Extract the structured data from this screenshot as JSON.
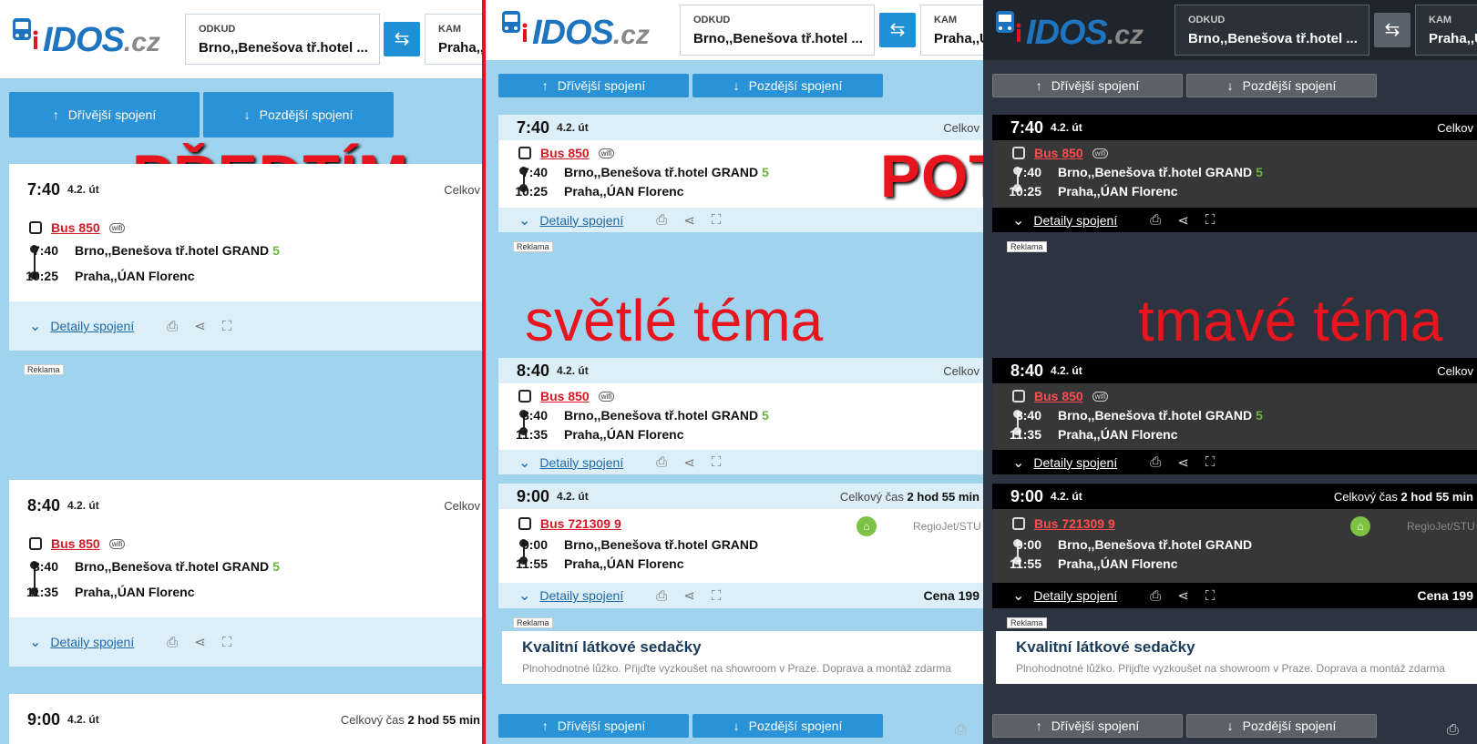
{
  "logo": {
    "word": "IDOS",
    "tld": ".cz"
  },
  "search": {
    "from_label": "ODKUD",
    "from_value": "Brno,,Benešova tř.hotel ...",
    "to_label": "KAM",
    "to_value": "Praha,,ÚAN Florenc",
    "to_value_short": "Praha,,Ú"
  },
  "nav": {
    "earlier": "Dřívější spojení",
    "later": "Pozdější spojení"
  },
  "labels": {
    "before": "PŘEDTÍM",
    "after": "POTOM",
    "light": "světlé téma",
    "dark": "tmavé téma",
    "ad": "Reklama",
    "details": "Detaily spojení",
    "total_prefix": "Celkový čas",
    "total_value": "2 hod 55 min",
    "total_short": "Celkov",
    "price": "Cena 199",
    "carrier": "RegioJet/STU"
  },
  "connections": [
    {
      "time": "7:40",
      "date": "4.2. út",
      "bus": "Bus 850",
      "dep": "7:40",
      "from": "Brno,,Benešova tř.hotel GRAND",
      "platform": "5",
      "arr": "10:25",
      "to": "Praha,,ÚAN Florenc"
    },
    {
      "time": "8:40",
      "date": "4.2. út",
      "bus": "Bus 850",
      "dep": "8:40",
      "from": "Brno,,Benešova tř.hotel GRAND",
      "platform": "5",
      "arr": "11:35",
      "to": "Praha,,ÚAN Florenc"
    },
    {
      "time": "9:00",
      "date": "4.2. út",
      "bus": "Bus 721309 9",
      "dep": "9:00",
      "from": "Brno,,Benešova tř.hotel GRAND",
      "platform": "",
      "arr": "11:55",
      "to": "Praha,,ÚAN Florenc"
    }
  ],
  "ad_box": {
    "title": "Kvalitní látkové sedačky",
    "subtitle": "Plnohodnotné lůžko. Přijďte vyzkoušet na showroom v Praze. Doprava a montáž zdarma"
  },
  "colors": {
    "brand": "#1e74be",
    "accent_red": "#e8141e",
    "button": "#2a92d6",
    "light_bg": "#9fd3ee",
    "dark_bg": "#2b3440"
  }
}
